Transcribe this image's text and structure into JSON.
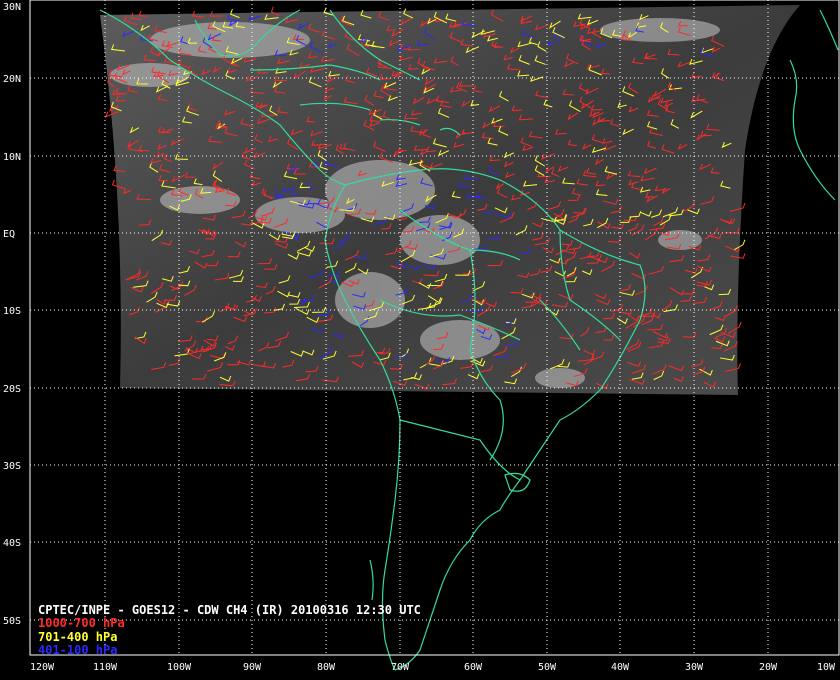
{
  "title": "CPTEC/INPE - GOES12 - CDW CH4 (IR) 20100316 12:30 UTC",
  "legend": [
    {
      "label": "1000-700 hPa",
      "color": "#ff2a2a"
    },
    {
      "label": "701-400 hPa",
      "color": "#ffff33"
    },
    {
      "label": "401-100 hPa",
      "color": "#2a2aff"
    }
  ],
  "lat_labels": [
    "30N",
    "20N",
    "10N",
    "EQ",
    "10S",
    "20S",
    "30S",
    "40S",
    "50S"
  ],
  "lon_labels": [
    "120W",
    "110W",
    "100W",
    "90W",
    "80W",
    "70W",
    "60W",
    "50W",
    "40W",
    "30W",
    "20W",
    "10W"
  ],
  "colors": {
    "background": "#000000",
    "grid": "#ffffff",
    "coast": "#33dd99",
    "satellite": "#4a4a4a"
  }
}
